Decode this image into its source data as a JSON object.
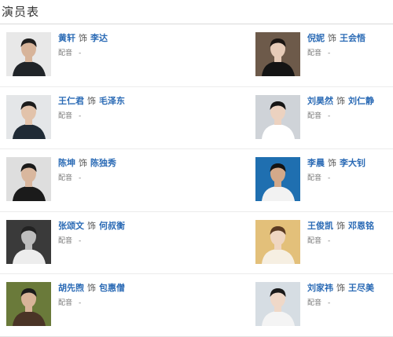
{
  "page_title": "演员表",
  "as_word": "饰",
  "voice_label": "配音",
  "cast": [
    {
      "actor": "黄轩",
      "character": "李达",
      "voice": "-",
      "photo": {
        "bg": "#e8e8e8",
        "hair": "#1e1e1e",
        "skin": "#d7b49a",
        "cloth": "#202428"
      }
    },
    {
      "actor": "倪妮",
      "character": "王会悟",
      "voice": "-",
      "photo": {
        "bg": "#6d5a4a",
        "hair": "#1a1512",
        "skin": "#e6cbb8",
        "cloth": "#141414"
      }
    },
    {
      "actor": "王仁君",
      "character": "毛泽东",
      "voice": "-",
      "photo": {
        "bg": "#e4e6e8",
        "hair": "#1c1c1c",
        "skin": "#e2c3ab",
        "cloth": "#1f2a35"
      }
    },
    {
      "actor": "刘昊然",
      "character": "刘仁静",
      "voice": "-",
      "photo": {
        "bg": "#cfd3d8",
        "hair": "#151515",
        "skin": "#ecd2c0",
        "cloth": "#ffffff"
      }
    },
    {
      "actor": "陈坤",
      "character": "陈独秀",
      "voice": "-",
      "photo": {
        "bg": "#dedede",
        "hair": "#1a1a1a",
        "skin": "#d9b79e",
        "cloth": "#1b1b1b"
      }
    },
    {
      "actor": "李晨",
      "character": "李大钊",
      "voice": "-",
      "photo": {
        "bg": "#1f6fb0",
        "hair": "#141414",
        "skin": "#d3a98a",
        "cloth": "#f2f2f2"
      }
    },
    {
      "actor": "张颂文",
      "character": "何叔衡",
      "voice": "-",
      "photo": {
        "bg": "#3a3a3a",
        "hair": "#222222",
        "skin": "#bdbdbd",
        "cloth": "#ededed"
      }
    },
    {
      "actor": "王俊凯",
      "character": "邓恩铭",
      "voice": "-",
      "photo": {
        "bg": "#e3c07a",
        "hair": "#5a3a22",
        "skin": "#efd6c2",
        "cloth": "#f6efe2"
      }
    },
    {
      "actor": "胡先煦",
      "character": "包惠僧",
      "voice": "-",
      "photo": {
        "bg": "#6a7a3a",
        "hair": "#1b1b1b",
        "skin": "#d8b398",
        "cloth": "#4a3426"
      }
    },
    {
      "actor": "刘家祎",
      "character": "王尽美",
      "voice": "-",
      "photo": {
        "bg": "#d6dde3",
        "hair": "#1a1a1a",
        "skin": "#efd8c8",
        "cloth": "#f4f4f4"
      }
    }
  ]
}
